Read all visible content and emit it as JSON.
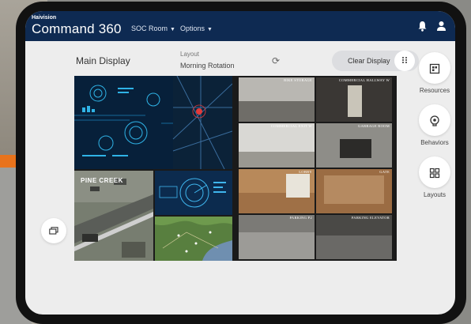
{
  "app": {
    "brand_top": "Haivision",
    "brand": "Command 360",
    "menu": [
      {
        "label": "SOC Room"
      },
      {
        "label": "Options"
      }
    ]
  },
  "icons": {
    "bell": "bell-icon",
    "user": "user-icon",
    "refresh": "refresh-icon",
    "grid": "dots-grid-icon",
    "resources": "resources-icon",
    "behaviors": "behaviors-icon",
    "layouts": "layouts-icon",
    "pip": "picture-in-picture-icon"
  },
  "main": {
    "title": "Main Display",
    "layout_label": "Layout",
    "layout_value": "Morning Rotation",
    "clear_label": "Clear Display"
  },
  "side_panel": [
    {
      "label": "Resources"
    },
    {
      "label": "Behaviors"
    },
    {
      "label": "Layouts"
    }
  ],
  "cameras": [
    {
      "label": "BIKE STORAGE"
    },
    {
      "label": "COMMERCIAL HALLWAY W"
    },
    {
      "label": "COMMERCIAL EXIT W"
    },
    {
      "label": "GARBAGE ROOM"
    },
    {
      "label": "LOBBY"
    },
    {
      "label": "GATE"
    },
    {
      "label": "PARKING P2"
    },
    {
      "label": "PARKING ELEVATOR"
    }
  ],
  "map_label": "PINE CREEK",
  "colors": {
    "header": "#0e2a52",
    "accent_orange": "#e8731c"
  }
}
